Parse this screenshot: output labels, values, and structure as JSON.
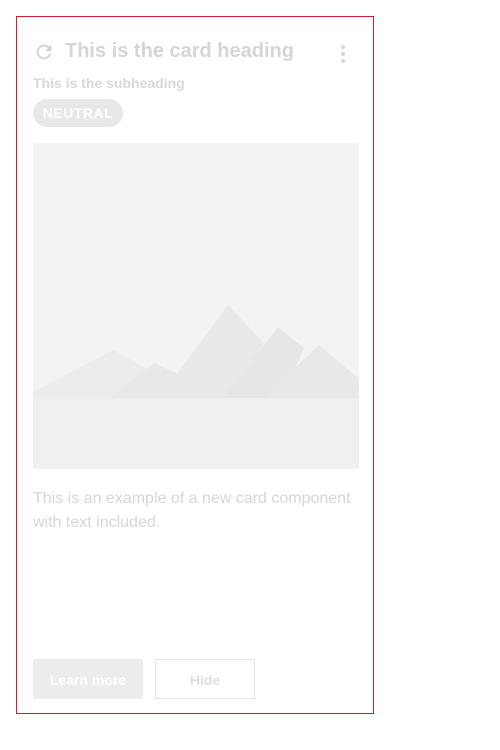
{
  "card": {
    "title": "This is the card heading",
    "subheading": "This is the subheading",
    "badge": "NEUTRAL",
    "body_text": "This is an example of a new card component with text included.",
    "actions": {
      "primary_label": "Learn more",
      "secondary_label": "Hide"
    },
    "icons": {
      "refresh": "refresh-icon",
      "more": "more-vertical-icon",
      "image_placeholder": "mountains-image-placeholder"
    },
    "colors": {
      "border": "#d51b2e",
      "placeholder_bg": "#f3f3f3",
      "muted_text": "#d6d6d6"
    }
  }
}
